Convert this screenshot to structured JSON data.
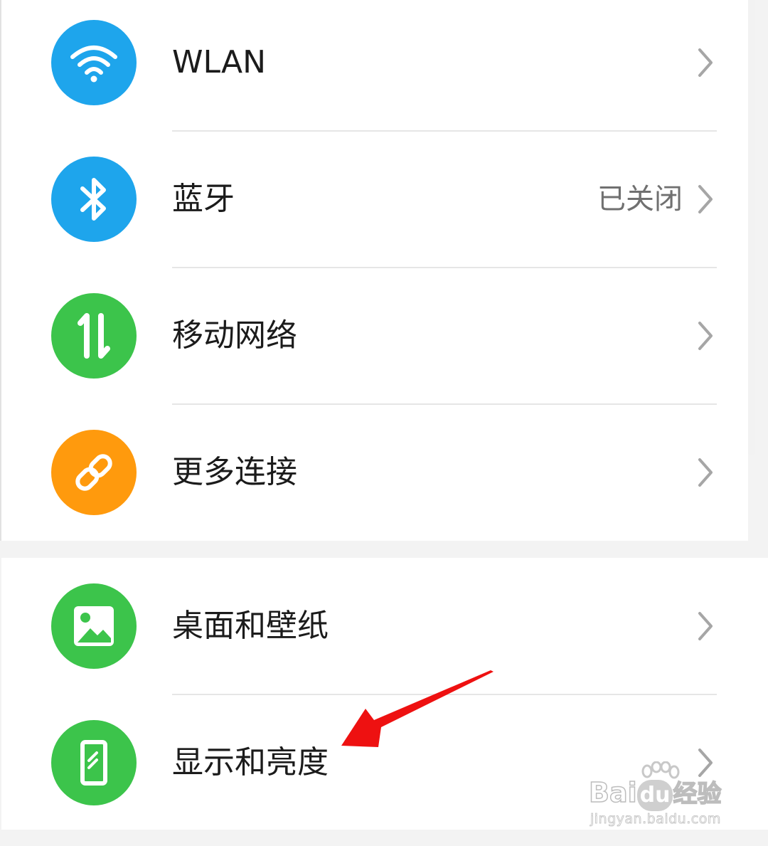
{
  "colors": {
    "wifi_blue": "#1ea5ec",
    "bluetooth_blue": "#1ea5ec",
    "green": "#3cc44b",
    "orange": "#ff9a0d",
    "arrow_red": "#ee1111"
  },
  "settings": {
    "group1": [
      {
        "label": "WLAN",
        "icon": "wifi-icon"
      },
      {
        "label": "蓝牙",
        "value": "已关闭",
        "icon": "bluetooth-icon"
      },
      {
        "label": "移动网络",
        "icon": "mobile-data-icon"
      },
      {
        "label": "更多连接",
        "icon": "link-icon"
      }
    ],
    "group2": [
      {
        "label": "桌面和壁纸",
        "icon": "image-icon"
      },
      {
        "label": "显示和亮度",
        "icon": "phone-display-icon"
      }
    ]
  },
  "watermark": {
    "brand": "Bai",
    "paw": "du",
    "suffix": "经验",
    "url": "jingyan.baidu.com"
  }
}
